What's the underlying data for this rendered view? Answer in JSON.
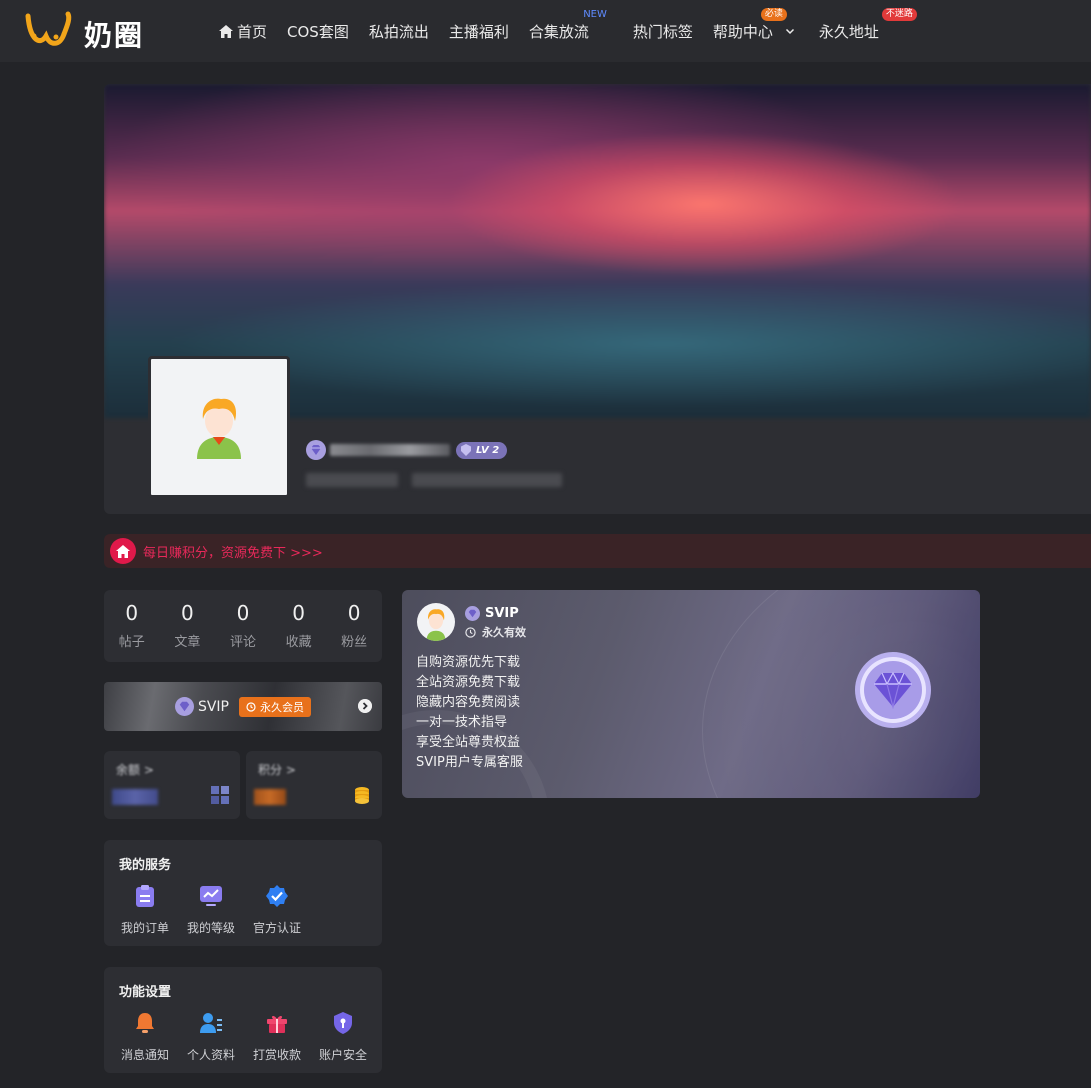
{
  "brand": {
    "logo_text": "奶圈"
  },
  "nav": {
    "items": [
      {
        "label": "首页",
        "icon": "home-icon"
      },
      {
        "label": "COS套图"
      },
      {
        "label": "私拍流出"
      },
      {
        "label": "主播福利"
      },
      {
        "label": "合集放流",
        "badge": "NEW"
      },
      {
        "label": "热门标签"
      },
      {
        "label": "帮助中心",
        "badge": "必读",
        "has_dropdown": true
      },
      {
        "label": "永久地址",
        "badge": "不迷路"
      }
    ]
  },
  "profile": {
    "level_badge": "LV 2"
  },
  "notice": {
    "text": "每日赚积分，资源免费下 >>>"
  },
  "stats": [
    {
      "value": "0",
      "label": "帖子"
    },
    {
      "value": "0",
      "label": "文章"
    },
    {
      "value": "0",
      "label": "评论"
    },
    {
      "value": "0",
      "label": "收藏"
    },
    {
      "value": "0",
      "label": "粉丝"
    }
  ],
  "svip_bar": {
    "label": "SVIP",
    "badge": "永久会员"
  },
  "wallet": {
    "balance_title": "余额 >",
    "points_title": "积分 >"
  },
  "services": {
    "title": "我的服务",
    "items": [
      {
        "label": "我的订单",
        "icon": "order-icon"
      },
      {
        "label": "我的等级",
        "icon": "level-chart-icon"
      },
      {
        "label": "官方认证",
        "icon": "verified-icon"
      }
    ]
  },
  "settings": {
    "title": "功能设置",
    "items": [
      {
        "label": "消息通知",
        "icon": "bell-icon"
      },
      {
        "label": "个人资料",
        "icon": "profile-icon"
      },
      {
        "label": "打赏收款",
        "icon": "gift-icon"
      },
      {
        "label": "账户安全",
        "icon": "shield-icon"
      }
    ]
  },
  "svip_card": {
    "title": "SVIP",
    "validity": "永久有效",
    "perks": [
      "自购资源优先下载",
      "全站资源免费下载",
      "隐藏内容免费阅读",
      "一对一技术指导",
      "享受全站尊贵权益",
      "SVIP用户专属客服"
    ]
  },
  "colors": {
    "background": "#232428",
    "panel": "#2d2e33",
    "accent_red": "#e0194a",
    "accent_orange": "#e8711b",
    "vip_purple": "#7b73b8"
  }
}
